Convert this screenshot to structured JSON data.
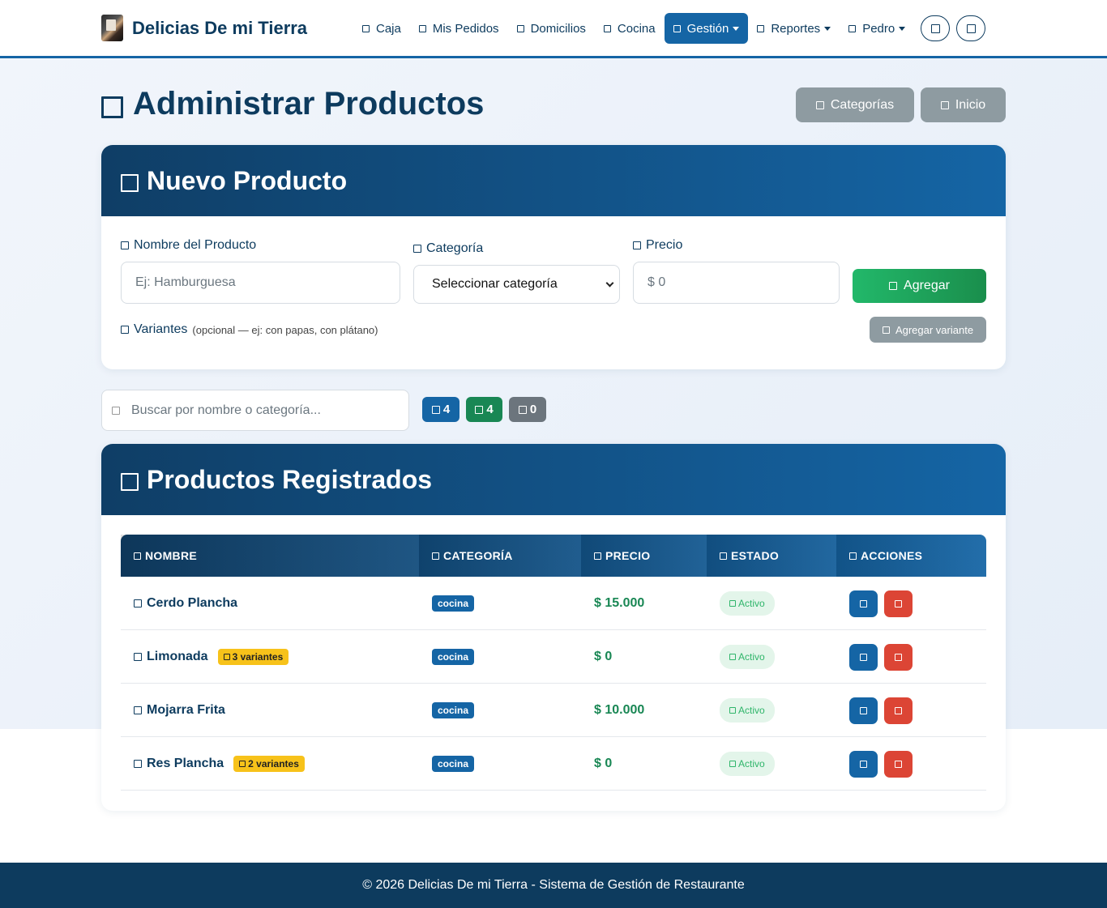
{
  "brand": {
    "name": "Delicias De mi Tierra"
  },
  "nav": {
    "items": [
      {
        "label": "Caja"
      },
      {
        "label": "Mis Pedidos"
      },
      {
        "label": "Domicilios"
      },
      {
        "label": "Cocina"
      },
      {
        "label": "Gestión"
      },
      {
        "label": "Reportes"
      },
      {
        "label": "Pedro"
      }
    ]
  },
  "page": {
    "title": "Administrar Productos",
    "btn_categories": "Categorías",
    "btn_home": "Inicio"
  },
  "form": {
    "title": "Nuevo Producto",
    "name_label": "Nombre del Producto",
    "name_placeholder": "Ej: Hamburguesa",
    "category_label": "Categoría",
    "category_selected": "Seleccionar categoría",
    "price_label": "Precio",
    "price_placeholder": "$ 0",
    "add_button": "Agregar",
    "variants_label": "Variantes",
    "variants_hint": "(opcional — ej: con papas, con plátano)",
    "add_variant_button": "Agregar variante"
  },
  "search": {
    "placeholder": "Buscar por nombre o categoría...",
    "counts": {
      "total": "4",
      "active": "4",
      "inactive": "0"
    }
  },
  "table": {
    "title": "Productos Registrados",
    "headers": {
      "name": "NOMBRE",
      "category": "CATEGORÍA",
      "price": "PRECIO",
      "status": "ESTADO",
      "actions": "ACCIONES"
    },
    "rows": [
      {
        "name": "Cerdo Plancha",
        "variants": "",
        "category": "cocina",
        "price": "$ 15.000",
        "status": "Activo"
      },
      {
        "name": "Limonada",
        "variants": "3 variantes",
        "category": "cocina",
        "price": "$ 0",
        "status": "Activo"
      },
      {
        "name": "Mojarra Frita",
        "variants": "",
        "category": "cocina",
        "price": "$ 10.000",
        "status": "Activo"
      },
      {
        "name": "Res Plancha",
        "variants": "2 variantes",
        "category": "cocina",
        "price": "$ 0",
        "status": "Activo"
      }
    ]
  },
  "footer": {
    "text": "© 2026 Delicias De mi Tierra - Sistema de Gestión de Restaurante"
  },
  "colors": {
    "primary": "#1565a5",
    "dark": "#0d3b5e",
    "success": "#198754",
    "danger": "#dc3545",
    "warning": "#f7c21a",
    "secondary": "#8e9ba1"
  }
}
